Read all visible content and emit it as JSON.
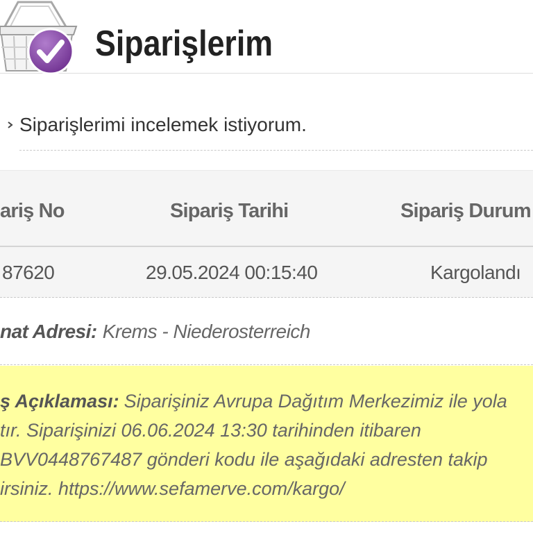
{
  "header": {
    "title": "Siparişlerim",
    "icon": "basket-check-icon"
  },
  "orders_toggle": {
    "icon": "chevron-right-icon",
    "label": "Siparişlerimi incelemek istiyorum."
  },
  "orders_table": {
    "columns": [
      "ariş No",
      "Sipariş Tarihi",
      "Sipariş Durum"
    ],
    "rows": [
      {
        "order_no": "87620",
        "date": "29.05.2024 00:15:40",
        "status": "Kargolandı"
      }
    ]
  },
  "shipping_address": {
    "label": "nat Adresi:",
    "value": "Krems - Niederosterreich"
  },
  "order_note": {
    "label": "ş Açıklaması:",
    "lines": [
      "Siparişiniz Avrupa Dağıtım Merkezimiz ile yola",
      "tır. Siparişinizi 06.06.2024 13:30 tarihinden itibaren",
      "BVV0448767487 gönderi kodu ile aşağıdaki adresten takip",
      "irsiniz. https://www.sefamerve.com/kargo/"
    ]
  },
  "colors": {
    "badge_purple": "#6e2f8f",
    "note_background": "#ffffa0",
    "text_gray": "#666666"
  }
}
